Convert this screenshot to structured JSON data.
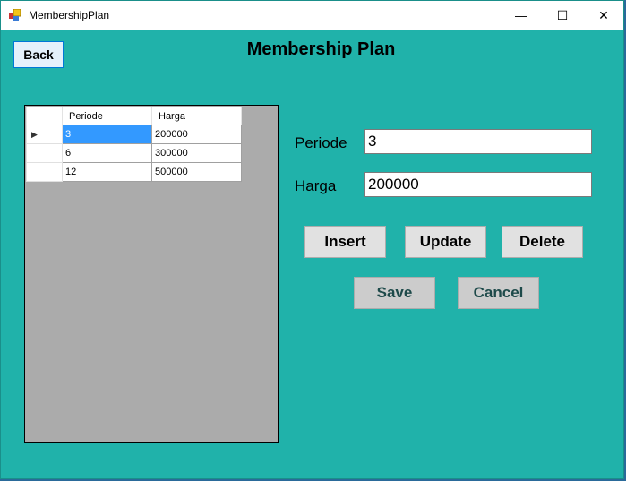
{
  "window": {
    "title": "MembershipPlan",
    "minimize": "—",
    "maximize": "☐",
    "close": "✕"
  },
  "heading": "Membership Plan",
  "back_label": "Back",
  "grid": {
    "columns": [
      "Periode",
      "Harga"
    ],
    "rows": [
      {
        "periode": "3",
        "harga": "200000",
        "selected": true
      },
      {
        "periode": "6",
        "harga": "300000"
      },
      {
        "periode": "12",
        "harga": "500000"
      }
    ],
    "current_row_marker": "▶"
  },
  "form": {
    "periode_label": "Periode",
    "periode_value": "3",
    "harga_label": "Harga",
    "harga_value": "200000"
  },
  "buttons": {
    "insert": "Insert",
    "update": "Update",
    "delete": "Delete",
    "save": "Save",
    "cancel": "Cancel"
  }
}
